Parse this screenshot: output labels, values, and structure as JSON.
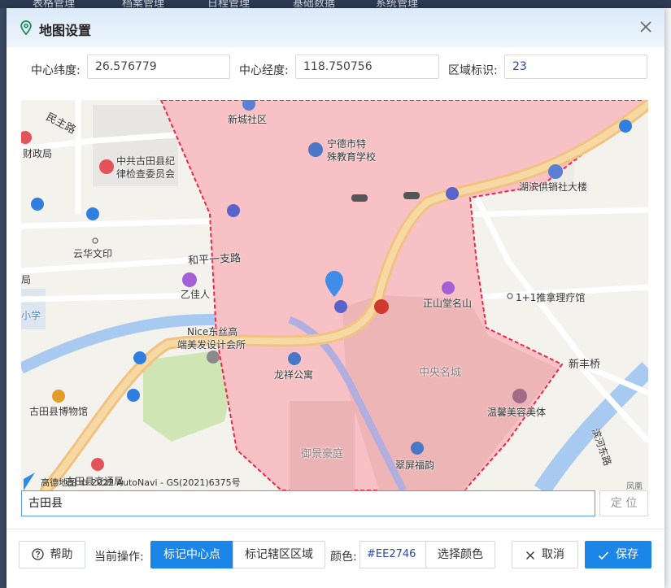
{
  "background_nav": [
    "表格管理",
    "档案管理",
    "日程管理",
    "基础数据",
    "系统管理"
  ],
  "dialog": {
    "title": "地图设置",
    "close_icon": "close-icon"
  },
  "fields": {
    "lat_label": "中心纬度:",
    "lat_value": "26.576779",
    "lng_label": "中心经度:",
    "lng_value": "118.750756",
    "region_label": "区域标识:",
    "region_value": "23"
  },
  "map": {
    "labels": {
      "minzhu_road": "民主路",
      "caizheng": "财政局",
      "jiwei_1": "中共古田县纪",
      "jiwei_2": "律检查委员会",
      "xincheng": "新城社区",
      "special_school_1": "宁德市特",
      "special_school_2": "殊教育学校",
      "huxin": "湖滨供销社大楼",
      "yunhua": "云华文印",
      "heping_road": "和平一支路",
      "yijia": "乙佳人",
      "zhengshantang": "正山堂名山",
      "tuina": "1+1推拿理疗馆",
      "nice_1": "Nice东丝高",
      "nice_2": "端美发设计会所",
      "longxiang": "龙祥公寓",
      "zhongyang": "中央名城",
      "xinfeng": "新丰桥",
      "wenxin": "温馨美容美体",
      "museum": "古田县博物馆",
      "yujing": "御景豪庭",
      "cuiping": "翠屏福韵",
      "jiaotong": "古田县交通局",
      "bingjiang_road": "滨河东路",
      "left_edge_ju": "局",
      "left_edge_xue": "小学",
      "attribution": "© 2022 AutoNavi - GS(2021)6375号",
      "logo_text": "高德地图",
      "corner_text": "凤凰"
    },
    "polygon_color": "#EE2746"
  },
  "search": {
    "value": "古田县",
    "locate_label": "定 位"
  },
  "footer": {
    "help_label": "帮助",
    "op_label": "当前操作:",
    "mark_center_label": "标记中心点",
    "mark_region_label": "标记辖区区域",
    "color_label": "颜色:",
    "color_value": "#EE2746",
    "choose_color_label": "选择颜色",
    "cancel_label": "取消",
    "save_label": "保存"
  },
  "colors": {
    "primary": "#1c86e8",
    "region_fill": "#f7c1c5",
    "region_stroke": "#EE2746"
  }
}
